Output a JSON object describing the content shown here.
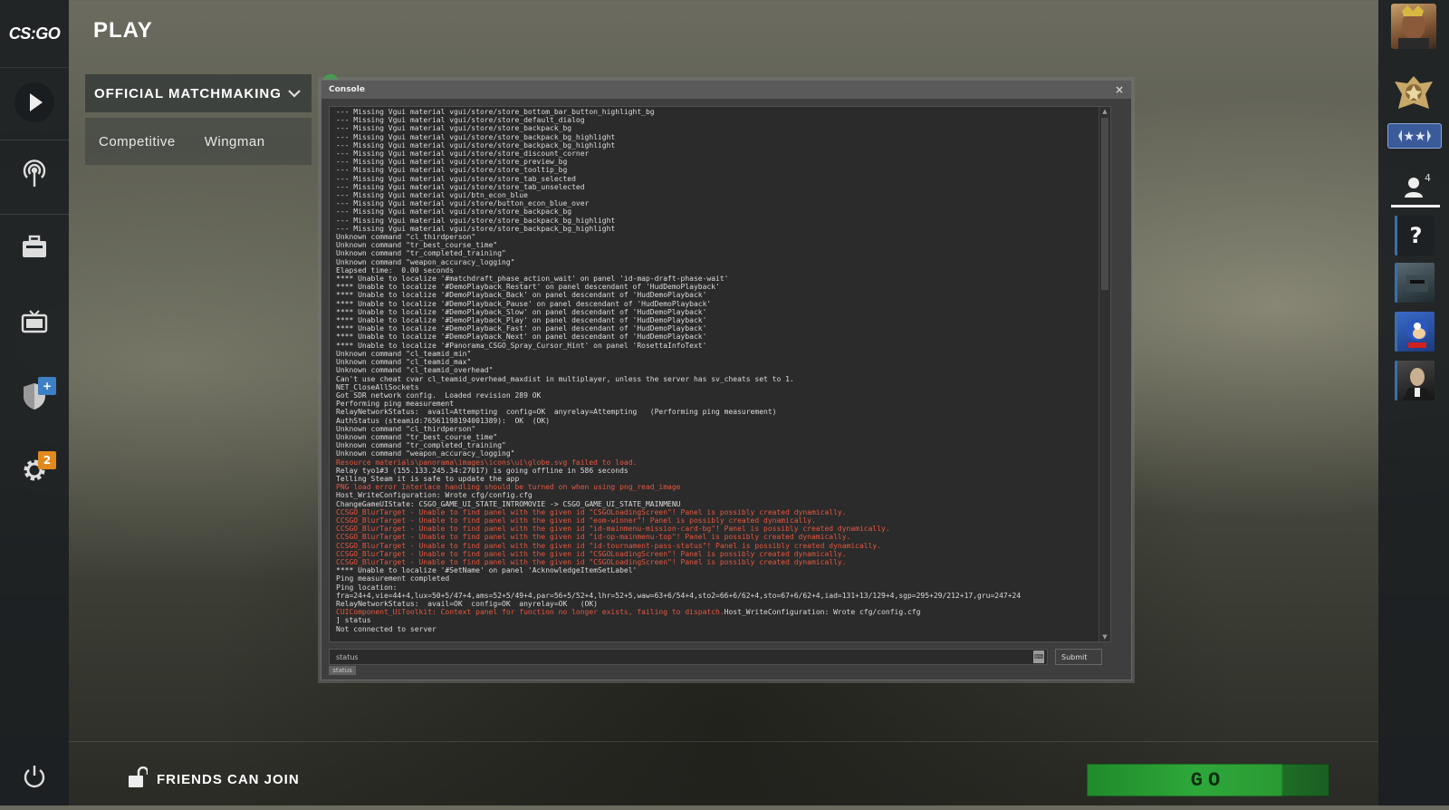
{
  "app": {
    "logo": "CS:GO",
    "page_title": "PLAY"
  },
  "left_nav": {
    "items": [
      {
        "name": "play-icon"
      },
      {
        "name": "broadcast-icon"
      },
      {
        "name": "inventory-icon"
      },
      {
        "name": "tv-icon"
      },
      {
        "name": "shield-icon",
        "badge": "+"
      },
      {
        "name": "gear-icon",
        "badge": "2"
      }
    ],
    "power": "power-icon"
  },
  "mode": {
    "selected": "OFFICIAL MATCHMAKING",
    "tabs": [
      "Competitive",
      "Wingman"
    ]
  },
  "right_panel": {
    "friends_count": "4",
    "help_label": "?"
  },
  "console": {
    "title": "Console",
    "close_label": "×",
    "log": [
      {
        "t": "--- Missing Vgui material vgui/store/store_bottom_bar_button_highlight_bg",
        "e": false
      },
      {
        "t": "--- Missing Vgui material vgui/store/store_default_dialog",
        "e": false
      },
      {
        "t": "--- Missing Vgui material vgui/store/store_backpack_bg",
        "e": false
      },
      {
        "t": "--- Missing Vgui material vgui/store/store_backpack_bg_highlight",
        "e": false
      },
      {
        "t": "--- Missing Vgui material vgui/store/store_backpack_bg_highlight",
        "e": false
      },
      {
        "t": "--- Missing Vgui material vgui/store/store_discount_corner",
        "e": false
      },
      {
        "t": "--- Missing Vgui material vgui/store/store_preview_bg",
        "e": false
      },
      {
        "t": "--- Missing Vgui material vgui/store/store_tooltip_bg",
        "e": false
      },
      {
        "t": "--- Missing Vgui material vgui/store/store_tab_selected",
        "e": false
      },
      {
        "t": "--- Missing Vgui material vgui/store/store_tab_unselected",
        "e": false
      },
      {
        "t": "--- Missing Vgui material vgui/btn_econ_blue",
        "e": false
      },
      {
        "t": "--- Missing Vgui material vgui/store/button_econ_blue_over",
        "e": false
      },
      {
        "t": "--- Missing Vgui material vgui/store/store_backpack_bg",
        "e": false
      },
      {
        "t": "--- Missing Vgui material vgui/store/store_backpack_bg_highlight",
        "e": false
      },
      {
        "t": "--- Missing Vgui material vgui/store/store_backpack_bg_highlight",
        "e": false
      },
      {
        "t": "Unknown command \"cl_thirdperson\"",
        "e": false
      },
      {
        "t": "Unknown command \"tr_best_course_time\"",
        "e": false
      },
      {
        "t": "Unknown command \"tr_completed_training\"",
        "e": false
      },
      {
        "t": "Unknown command \"weapon_accuracy_logging\"",
        "e": false
      },
      {
        "t": "Elapsed time:  0.00 seconds",
        "e": false
      },
      {
        "t": "**** Unable to localize '#matchdraft_phase_action_wait' on panel 'id-map-draft-phase-wait'",
        "e": false
      },
      {
        "t": "**** Unable to localize '#DemoPlayback_Restart' on panel descendant of 'HudDemoPlayback'",
        "e": false
      },
      {
        "t": "**** Unable to localize '#DemoPlayback_Back' on panel descendant of 'HudDemoPlayback'",
        "e": false
      },
      {
        "t": "**** Unable to localize '#DemoPlayback_Pause' on panel descendant of 'HudDemoPlayback'",
        "e": false
      },
      {
        "t": "**** Unable to localize '#DemoPlayback_Slow' on panel descendant of 'HudDemoPlayback'",
        "e": false
      },
      {
        "t": "**** Unable to localize '#DemoPlayback_Play' on panel descendant of 'HudDemoPlayback'",
        "e": false
      },
      {
        "t": "**** Unable to localize '#DemoPlayback_Fast' on panel descendant of 'HudDemoPlayback'",
        "e": false
      },
      {
        "t": "**** Unable to localize '#DemoPlayback_Next' on panel descendant of 'HudDemoPlayback'",
        "e": false
      },
      {
        "t": "**** Unable to localize '#Panorama_CSGO_Spray_Cursor_Hint' on panel 'RosettaInfoText'",
        "e": false
      },
      {
        "t": "Unknown command \"cl_teamid_min\"",
        "e": false
      },
      {
        "t": "Unknown command \"cl_teamid_max\"",
        "e": false
      },
      {
        "t": "Unknown command \"cl_teamid_overhead\"",
        "e": false
      },
      {
        "t": "Can't use cheat cvar cl_teamid_overhead_maxdist in multiplayer, unless the server has sv_cheats set to 1.",
        "e": false
      },
      {
        "t": "NET_CloseAllSockets",
        "e": false
      },
      {
        "t": "Got SDR network config.  Loaded revision 289 OK",
        "e": false
      },
      {
        "t": "Performing ping measurement",
        "e": false
      },
      {
        "t": "RelayNetworkStatus:  avail=Attempting  config=OK  anyrelay=Attempting   (Performing ping measurement)",
        "e": false
      },
      {
        "t": "AuthStatus (steamid:76561198194001389):  OK  (OK)",
        "e": false
      },
      {
        "t": "Unknown command \"cl_thirdperson\"",
        "e": false
      },
      {
        "t": "Unknown command \"tr_best_course_time\"",
        "e": false
      },
      {
        "t": "Unknown command \"tr_completed_training\"",
        "e": false
      },
      {
        "t": "Unknown command \"weapon_accuracy_logging\"",
        "e": false
      },
      {
        "t": "Resource materials\\panorama\\images\\icons\\ui\\globe.svg failed to load.",
        "e": true
      },
      {
        "t": "Relay tyo1#3 (155.133.245.34:27017) is going offline in 586 seconds",
        "e": false
      },
      {
        "t": "Telling Steam it is safe to update the app",
        "e": false
      },
      {
        "t": "PNG load error Interlace handling should be turned on when using png_read_image",
        "e": true
      },
      {
        "t": "Host_WriteConfiguration: Wrote cfg/config.cfg",
        "e": false
      },
      {
        "t": "ChangeGameUIState: CSGO_GAME_UI_STATE_INTROMOVIE -> CSGO_GAME_UI_STATE_MAINMENU",
        "e": false
      },
      {
        "t": "CCSGO_BlurTarget - Unable to find panel with the given id \"CSGOLoadingScreen\"! Panel is possibly created dynamically.",
        "e": true
      },
      {
        "t": "CCSGO_BlurTarget - Unable to find panel with the given id \"eom-winner\"! Panel is possibly created dynamically.",
        "e": true
      },
      {
        "t": "CCSGO_BlurTarget - Unable to find panel with the given id \"id-mainmenu-mission-card-bg\"! Panel is possibly created dynamically.",
        "e": true
      },
      {
        "t": "CCSGO_BlurTarget - Unable to find panel with the given id \"id-op-mainmenu-top\"! Panel is possibly created dynamically.",
        "e": true
      },
      {
        "t": "CCSGO_BlurTarget - Unable to find panel with the given id \"id-tournament-pass-status\"! Panel is possibly created dynamically.",
        "e": true
      },
      {
        "t": "CCSGO_BlurTarget - Unable to find panel with the given id \"CSGOLoadingScreen\"! Panel is possibly created dynamically.",
        "e": true
      },
      {
        "t": "CCSGO_BlurTarget - Unable to find panel with the given id \"CSGOLoadingScreen\"! Panel is possibly created dynamically.",
        "e": true
      },
      {
        "t": "**** Unable to localize '#SetName' on panel 'AcknowledgeItemSetLabel'",
        "e": false
      },
      {
        "t": "Ping measurement completed",
        "e": false
      },
      {
        "t": "Ping location:",
        "e": false
      },
      {
        "t": "fra=24+4,vie=44+4,lux=50+5/47+4,ams=52+5/49+4,par=56+5/52+4,lhr=52+5,waw=63+6/54+4,sto2=66+6/62+4,sto=67+6/62+4,iad=131+13/129+4,sgp=295+29/212+17,gru=247+24",
        "e": false
      },
      {
        "t": "RelayNetworkStatus:  avail=OK  config=OK  anyrelay=OK   (OK)",
        "e": false
      },
      {
        "t": "CUIComponent_UiToolkit: Context panel for function no longer exists, failing to dispatch.",
        "e": true,
        "tail": "Host_WriteConfiguration: Wrote cfg/config.cfg"
      },
      {
        "t": "] status",
        "e": false
      },
      {
        "t": "Not connected to server",
        "e": false
      }
    ],
    "input_value": "status",
    "submit_label": "Submit",
    "autocomplete": "status"
  },
  "bottom": {
    "friends_label": "FRIENDS CAN JOIN",
    "go_label": "GO"
  }
}
